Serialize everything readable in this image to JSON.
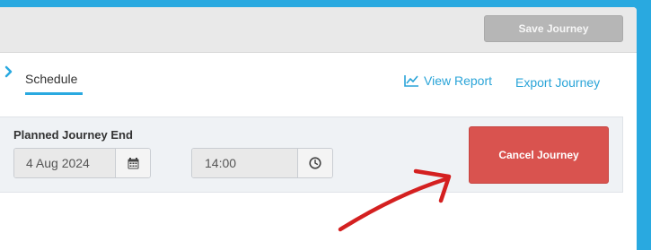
{
  "header": {
    "save_label": "Save Journey"
  },
  "tabs": {
    "active_label": "Schedule"
  },
  "actions": {
    "view_report_label": "View Report",
    "export_label": "Export Journey"
  },
  "form": {
    "label": "Planned Journey End",
    "date_value": "4 Aug 2024",
    "time_value": "14:00",
    "cancel_label": "Cancel Journey"
  },
  "icons": {
    "crumb": "chevron-right-icon",
    "report": "line-chart-icon",
    "date": "calendar-icon",
    "time": "clock-icon"
  },
  "colors": {
    "accent": "#29a9e0",
    "link": "#2aa4d8",
    "danger": "#d9534f",
    "disabled": "#b6b6b6",
    "annotation": "#d42020"
  }
}
